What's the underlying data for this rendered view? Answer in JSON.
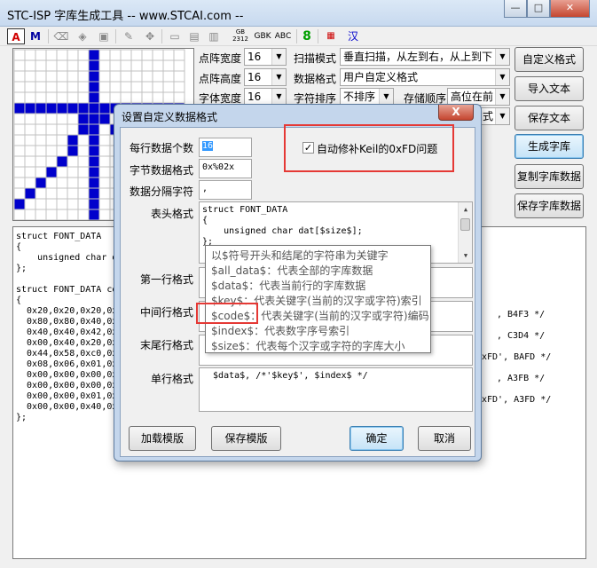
{
  "window": {
    "title": "STC-ISP 字库生成工具 -- www.STCAI.com --",
    "minimize": "—",
    "maximize": "□",
    "close": "✕"
  },
  "toolbar": {
    "bold_a": "A",
    "bold_m": "M",
    "gb2312": "GB 2312",
    "gbk": "GBK",
    "abc": "ABC",
    "eight": "8",
    "han": "汉"
  },
  "settings": {
    "dot_width_label": "点阵宽度",
    "dot_width_value": "16",
    "dot_height_label": "点阵高度",
    "dot_height_value": "16",
    "font_width_label": "字体宽度",
    "font_width_value": "16",
    "scan_mode_label": "扫描模式",
    "scan_mode_value": "垂直扫描，从左到右，从上到下",
    "data_format_label": "数据格式",
    "data_format_value": "用户自定义格式",
    "char_sort_label": "字符排序",
    "char_sort_value": "不排序",
    "store_order_label": "存储顺序",
    "store_order_value": "高位在前",
    "hidden_select_tail": "式"
  },
  "buttons": {
    "custom_format": "自定义格式",
    "import_text": "导入文本",
    "save_text": "保存文本",
    "generate": "生成字库",
    "copy_data": "复制字库数据",
    "save_data": "保存字库数据"
  },
  "code": {
    "lines": [
      "struct FONT_DATA",
      "{",
      "    unsigned char d",
      "};",
      "",
      "struct FONT_DATA co",
      "{",
      "  0x20,0x20,0x20,0x",
      "  0x80,0x80,0x40,0x",
      "  0x40,0x40,0x42,0x",
      "  0x00,0x40,0x20,0x",
      "  0x44,0x58,0xc0,0x",
      "  0x08,0x06,0x01,0x",
      "  0x00,0x00,0x00,0x",
      "  0x00,0x00,0x00,0x",
      "  0x00,0x00,0x01,0x",
      "  0x00,0x00,0x40,0x",
      "};"
    ],
    "right_fragments": [
      ", B4F3 */",
      ", C3D4 */",
      "xFD', BAFD */",
      ", A3FB */",
      "xFD', A3FD */"
    ]
  },
  "dialog": {
    "title": "设置自定义数据格式",
    "close": "X",
    "per_line_label": "每行数据个数",
    "per_line_value": "16",
    "byte_format_label": "字节数据格式",
    "byte_format_value": "0x%02x",
    "separator_label": "数据分隔字符",
    "separator_value": ",",
    "keil_fix_label": "自动修补Keil的0xFD问题",
    "keil_fix_checked": "✓",
    "header_label": "表头格式",
    "header_lines": [
      "struct FONT_DATA",
      "{",
      "    unsigned char dat[$size$];",
      "};"
    ],
    "first_line_label": "第一行格式",
    "middle_line_label": "中间行格式",
    "last_line_label": "末尾行格式",
    "single_line_label": "单行格式",
    "single_line_value": "  $data$, /*'$key$', $index$ */",
    "load_template": "加载模版",
    "save_template": "保存模版",
    "ok": "确定",
    "cancel": "取消"
  },
  "tooltip": {
    "lines": [
      "以$符号开头和结尾的字符串为关键字",
      "$all_data$：代表全部的字库数据",
      "$data$：代表当前行的字库数据",
      "$key$：代表关键字(当前的汉字或字符)索引",
      "$code$：代表关键字(当前的汉字或字符)编码",
      "$index$：代表数字序号索引",
      "$size$：代表每个汉字或字符的字库大小"
    ]
  },
  "colors": {
    "grid_on": "#0000cc",
    "grid_line": "#c0c0c0",
    "highlight": "#e53935"
  }
}
